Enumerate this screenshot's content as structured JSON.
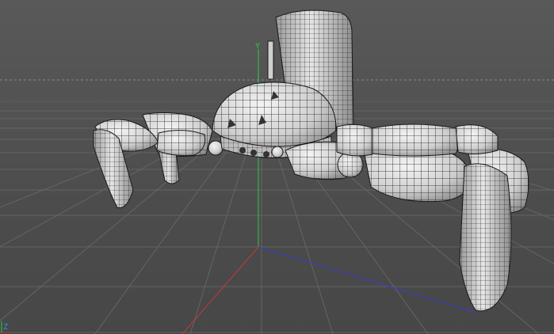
{
  "viewport": {
    "type": "3d-perspective-view",
    "render_mode": "wireframe-on-shaded",
    "background_color": "#4f4f4f",
    "grid_color": "#6a6a6a",
    "horizon_line_style": "dashed"
  },
  "axes": {
    "y_label": "Y",
    "z_label": "Z",
    "y_color": "#2fc845",
    "x_color": "#c23a3a",
    "z_color": "#3a3ad0"
  },
  "model": {
    "description_icon": "spider-tank-robot-icon",
    "shading_color": "#d9d9d9",
    "wire_color": "#1a1a1a"
  }
}
